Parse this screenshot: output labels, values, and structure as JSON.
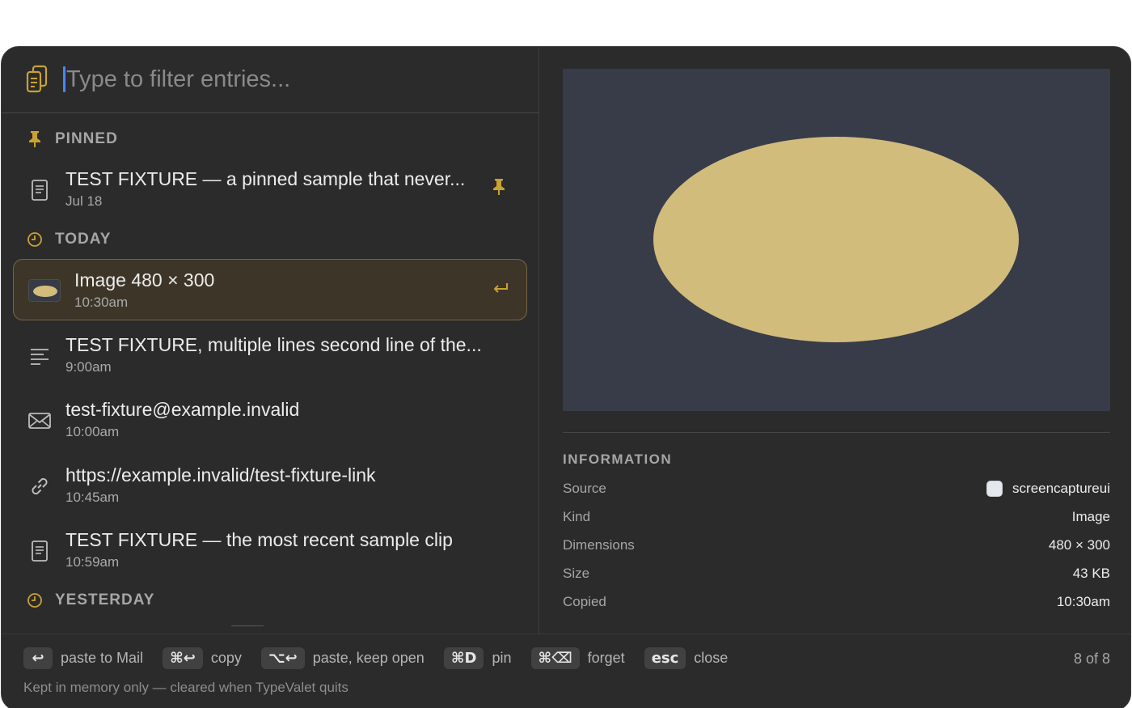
{
  "search": {
    "placeholder": "Type to filter entries..."
  },
  "sections": {
    "pinned": "PINNED",
    "today": "TODAY",
    "yesterday": "YESTERDAY"
  },
  "entries": [
    {
      "title": "TEST FIXTURE — a pinned sample that never...",
      "time": "Jul 18",
      "icon": "document-icon",
      "pinned": true
    },
    {
      "title": "Image 480 × 300",
      "time": "10:30am",
      "icon": "image-thumbnail",
      "selected": true
    },
    {
      "title": "TEST FIXTURE, multiple lines second line of the...",
      "time": "9:00am",
      "icon": "text-lines-icon"
    },
    {
      "title": "test-fixture@example.invalid",
      "time": "10:00am",
      "icon": "envelope-icon"
    },
    {
      "title": "https://example.invalid/test-fixture-link",
      "time": "10:45am",
      "icon": "link-icon"
    },
    {
      "title": "TEST FIXTURE — the most recent sample clip",
      "time": "10:59am",
      "icon": "document-icon"
    }
  ],
  "info": {
    "title": "INFORMATION",
    "rows": [
      {
        "key": "Source",
        "value": "screencaptureui"
      },
      {
        "key": "Kind",
        "value": "Image"
      },
      {
        "key": "Dimensions",
        "value": "480 × 300"
      },
      {
        "key": "Size",
        "value": "43 KB"
      },
      {
        "key": "Copied",
        "value": "10:30am"
      }
    ]
  },
  "preview": {
    "background": "#373c48",
    "shape_color": "#d2bc7c"
  },
  "footer": {
    "hints": [
      {
        "key": "↩",
        "label": "paste to Mail"
      },
      {
        "key": "⌘↩",
        "label": "copy"
      },
      {
        "key": "⌥↩",
        "label": "paste, keep open"
      },
      {
        "key": "⌘D",
        "label": "pin"
      },
      {
        "key": "⌘⌫",
        "label": "forget"
      },
      {
        "key": "esc",
        "label": "close"
      }
    ],
    "counter": "8 of 8",
    "note": "Kept in memory only — cleared when TypeValet quits"
  },
  "colors": {
    "accent": "#c9a233",
    "caret": "#4a86ff",
    "panel": "#2b2b2b"
  }
}
